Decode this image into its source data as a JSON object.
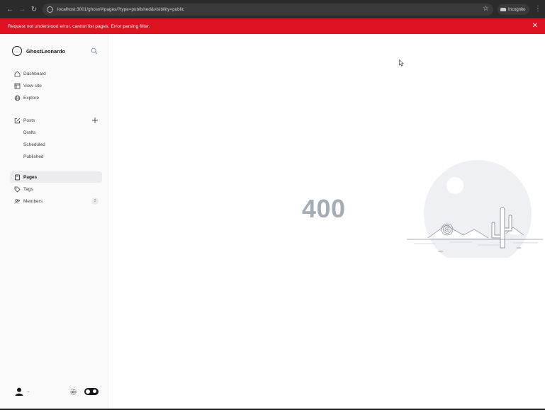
{
  "browser": {
    "url": "localhost:3001/ghost/#/pages/?type=published&visibility=public",
    "profile_label": "Incognito"
  },
  "banner": {
    "message": "Request not understood error, cannot list pages. Error parsing filter.",
    "close_glyph": "✕"
  },
  "sidebar": {
    "site_name": "GhostLeonardo",
    "items": [
      {
        "label": "Dashboard",
        "icon": "home-icon"
      },
      {
        "label": "View site",
        "icon": "browser-icon"
      },
      {
        "label": "Explore",
        "icon": "globe-icon"
      }
    ],
    "posts": {
      "label": "Posts",
      "icon": "pencil-square-icon",
      "sub_items": [
        "Drafts",
        "Scheduled",
        "Published"
      ]
    },
    "pages_label": "Pages",
    "tags_label": "Tags",
    "members_label": "Members",
    "members_count": "2"
  },
  "main": {
    "error_code": "400"
  },
  "colors": {
    "banner": "#e0111f",
    "sidebar_bg": "#fafafb",
    "error_code": "#a4acb5",
    "accent_dark": "#15171a"
  }
}
